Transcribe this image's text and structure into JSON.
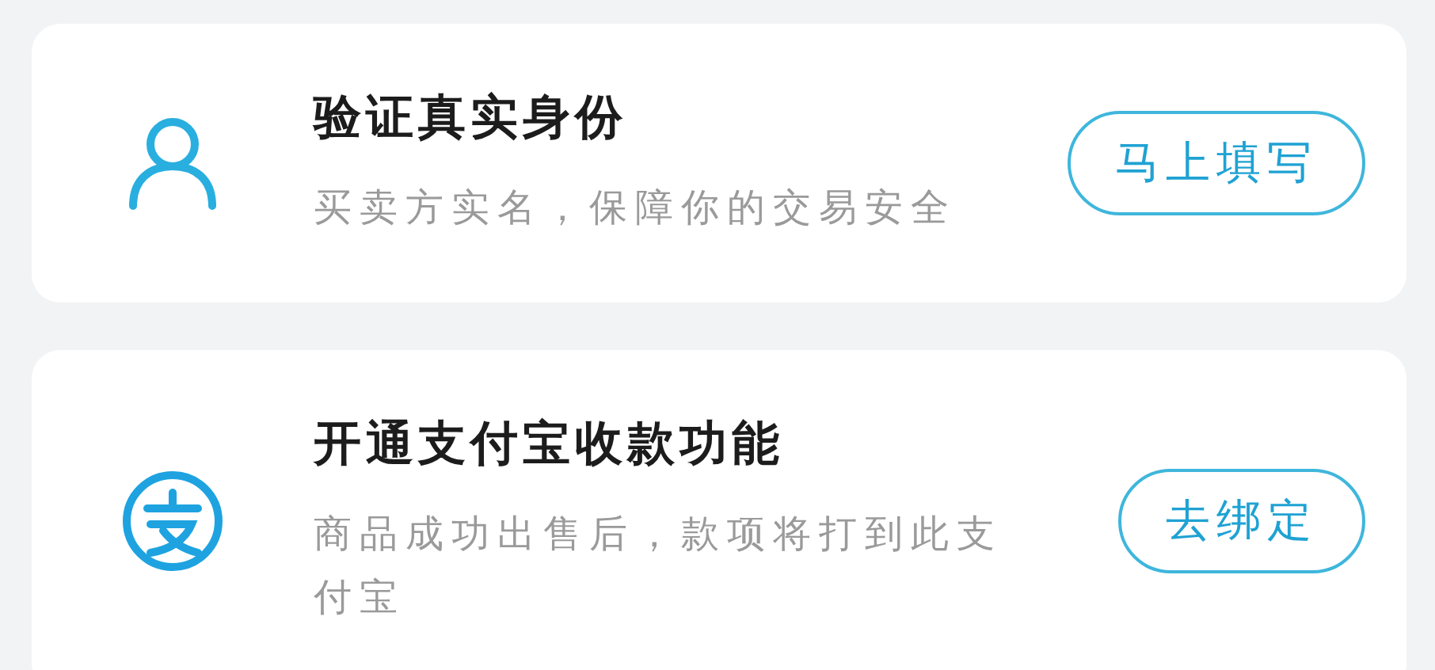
{
  "cards": [
    {
      "kind": "person",
      "title": "验证真实身份",
      "subtitle": "买卖方实名，保障你的交易安全",
      "button": "马上填写"
    },
    {
      "kind": "payment",
      "title": "开通支付宝收款功能",
      "subtitle": "商品成功出售后，款项将打到此支付宝",
      "button": "去绑定"
    }
  ]
}
